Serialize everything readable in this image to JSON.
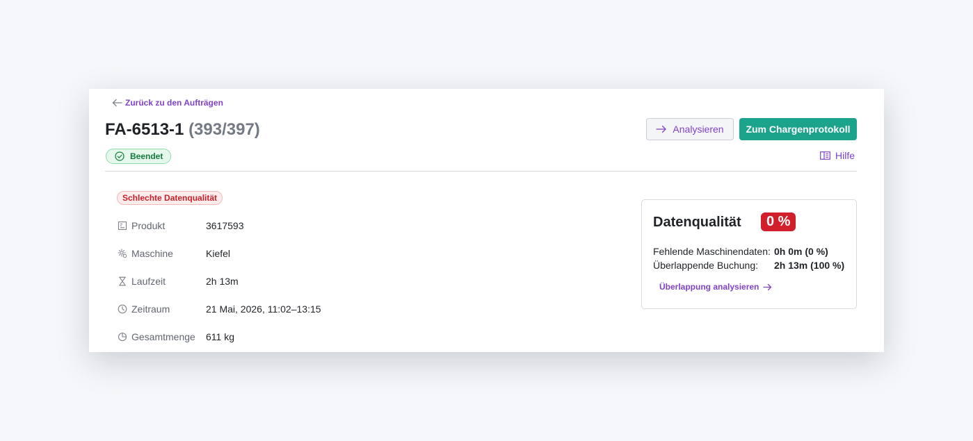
{
  "nav": {
    "back_label": "Zurück zu den Aufträgen"
  },
  "header": {
    "order_id": "FA-6513-1",
    "order_count": "(393/397)",
    "status": "Beendet",
    "analyze_label": "Analysieren",
    "protocol_label": "Zum Chargenprotokoll",
    "help_label": "Hilfe"
  },
  "details": {
    "quality_badge": "Schlechte Datenqualität",
    "fields": [
      {
        "label": "Produkt",
        "value": "3617593",
        "icon": "product-icon"
      },
      {
        "label": "Maschine",
        "value": "Kiefel",
        "icon": "machine-gear-icon"
      },
      {
        "label": "Laufzeit",
        "value": "2h 13m",
        "icon": "hourglass-icon"
      },
      {
        "label": "Zeitraum",
        "value": "21 Mai, 2026, 11:02–13:15",
        "icon": "clock-icon"
      },
      {
        "label": "Gesamtmenge",
        "value": "611 kg",
        "icon": "pie-chart-icon"
      }
    ]
  },
  "data_quality": {
    "title": "Datenqualität",
    "percent": "0 %",
    "rows": [
      {
        "label": "Fehlende Maschinendaten:",
        "value": "0h 0m (0 %)"
      },
      {
        "label": "Überlappende Buchung:",
        "value": "2h 13m (100 %)"
      }
    ],
    "link_label": "Überlappung analysieren"
  },
  "colors": {
    "accent": "#7f42c9",
    "primary_button": "#1ba38c",
    "success": "#127a3b",
    "danger": "#d11f2b"
  }
}
